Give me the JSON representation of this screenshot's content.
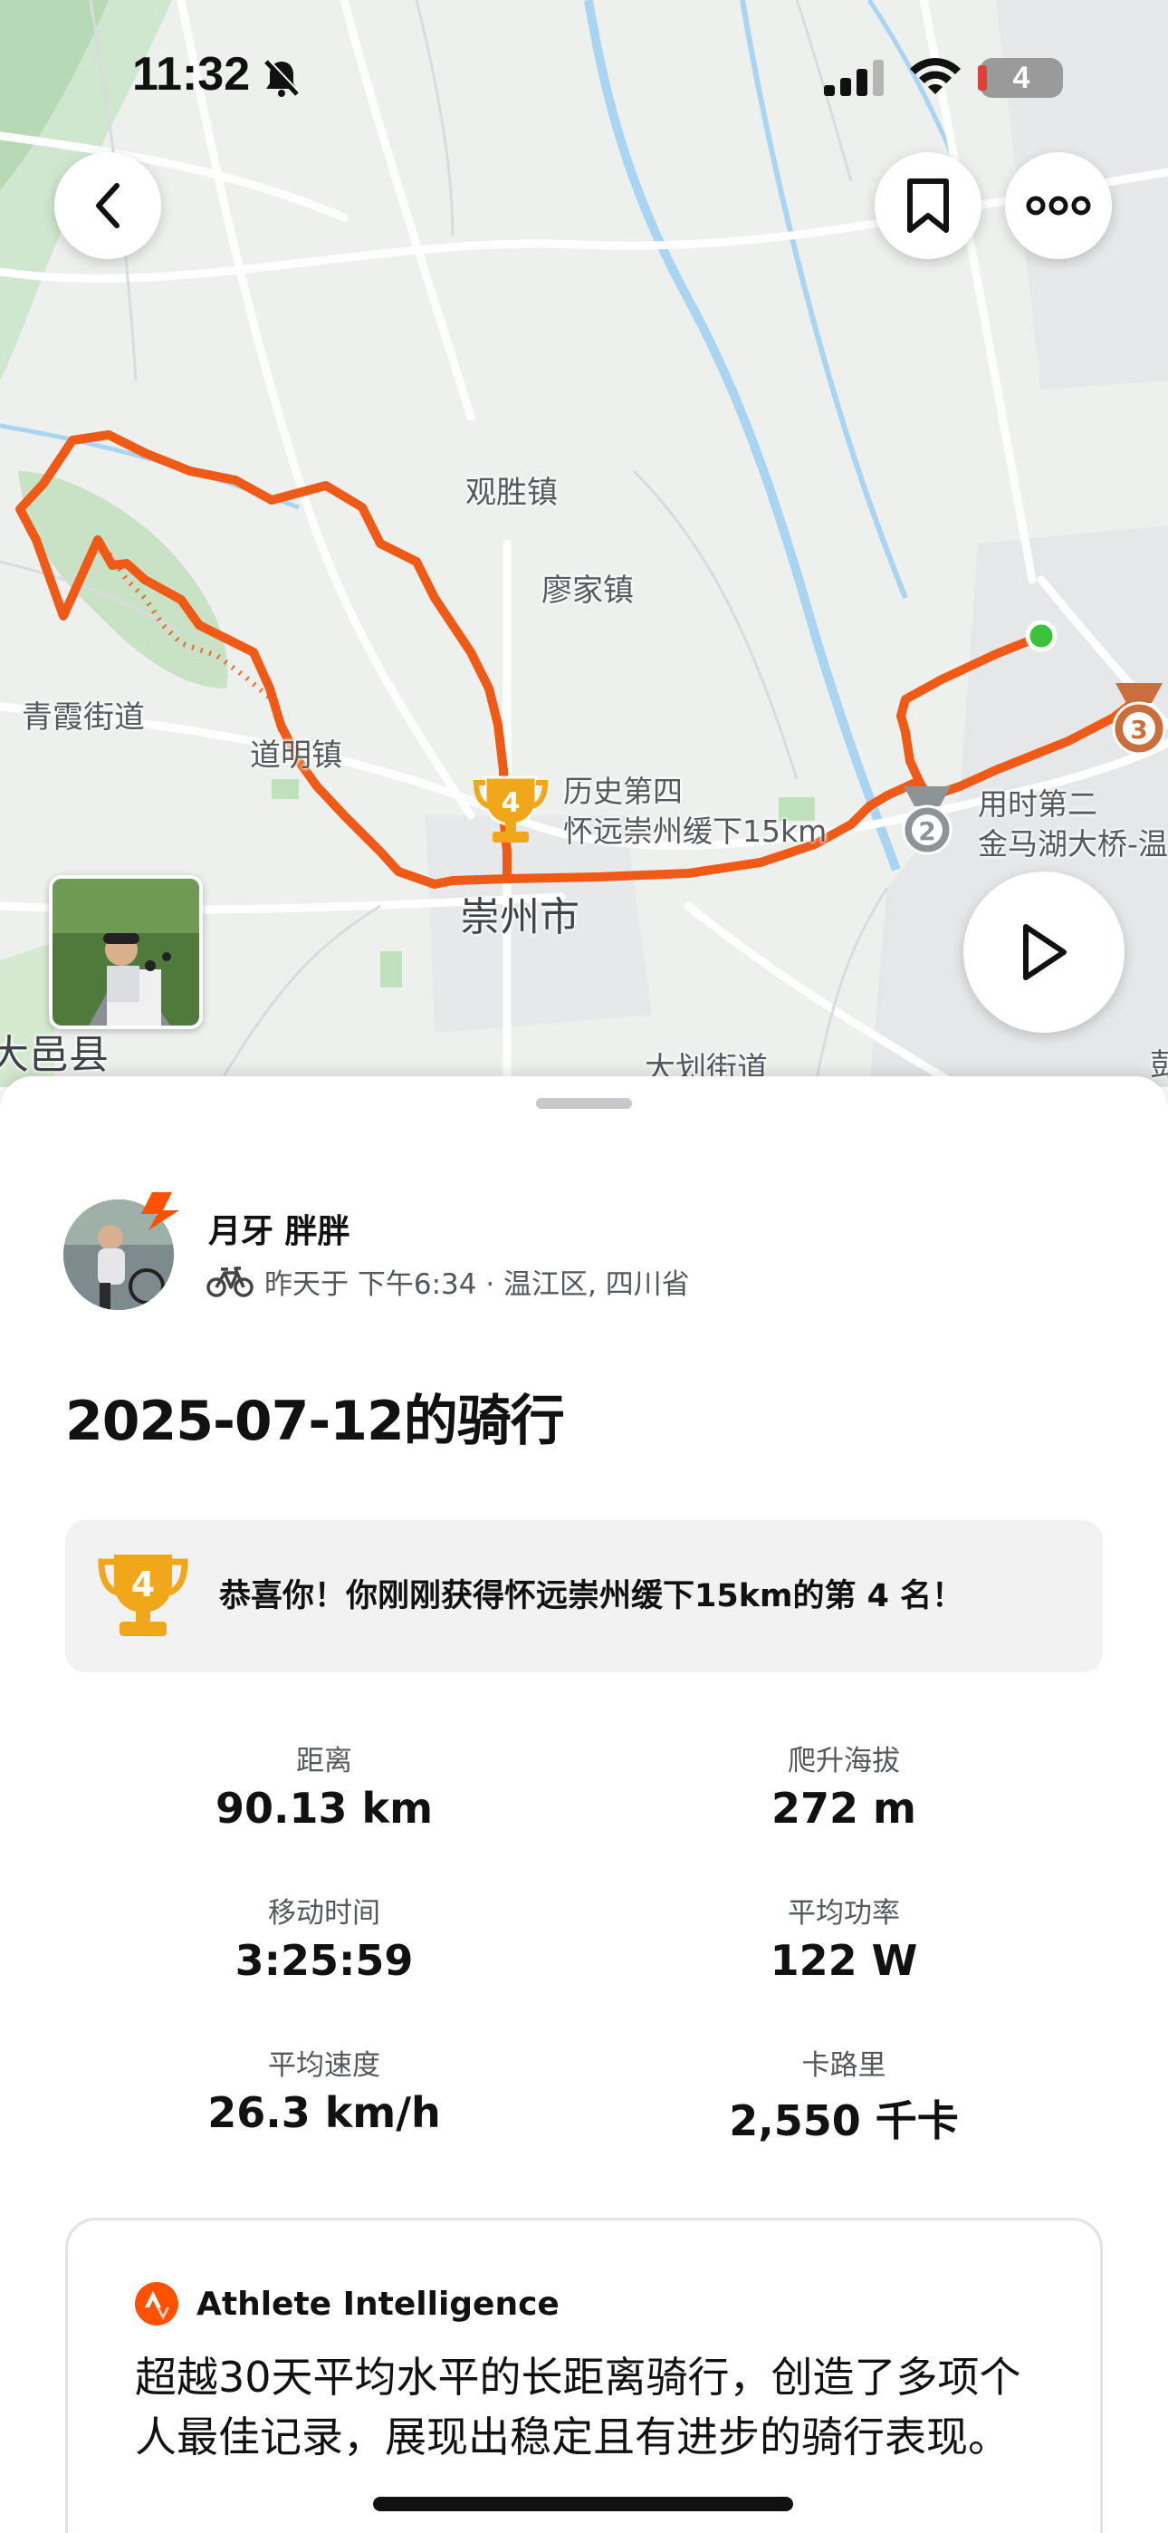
{
  "status_bar": {
    "time": "11:32",
    "battery": "4"
  },
  "map": {
    "labels": {
      "guansheng": "观胜镇",
      "liaojia": "廖家镇",
      "qingxia": "青霞街道",
      "daoming": "道明镇",
      "chongzhou": "崇州市",
      "dayi": "大邑县",
      "dahua": "大划街道",
      "edge_char": "彭"
    },
    "segments": [
      {
        "rank": "4",
        "line1": "历史第四",
        "line2": "怀远崇州缓下15km"
      },
      {
        "rank": "2",
        "line1": "用时第二",
        "line2": "金马湖大桥-温"
      },
      {
        "rank": "3"
      }
    ],
    "colors": {
      "route": "#f05a17",
      "gold": "#f0a81a",
      "silver": "#8e9396",
      "bronze": "#c96f3e",
      "start": "#3cc23a"
    }
  },
  "athlete": {
    "name": "月牙 胖胖",
    "meta": "昨天于 下午6:34 · 温江区, 四川省"
  },
  "activity": {
    "title": "2025-07-12的骑行"
  },
  "achievement": {
    "text": "恭喜你！你刚刚获得怀远崇州缓下15km的第 4 名！",
    "rank": "4"
  },
  "stats": [
    {
      "label": "距离",
      "value": "90.13 km"
    },
    {
      "label": "爬升海拔",
      "value": "272 m"
    },
    {
      "label": "移动时间",
      "value": "3:25:59"
    },
    {
      "label": "平均功率",
      "value": "122 W"
    },
    {
      "label": "平均速度",
      "value": "26.3 km/h"
    },
    {
      "label": "卡路里",
      "value": "2,550 千卡"
    }
  ],
  "ai": {
    "title": "Athlete Intelligence",
    "summary": "超越30天平均水平的长距离骑行，创造了多项个人最佳记录，展现出稳定且有进步的骑行表现。"
  },
  "icons": {
    "back": "chevron-left-icon",
    "bookmark": "bookmark-icon",
    "more": "more-icon",
    "play": "play-icon",
    "bell": "bell-slash-icon",
    "bike": "bike-icon",
    "trophy": "trophy-icon"
  },
  "brand_color": "#fc5200"
}
